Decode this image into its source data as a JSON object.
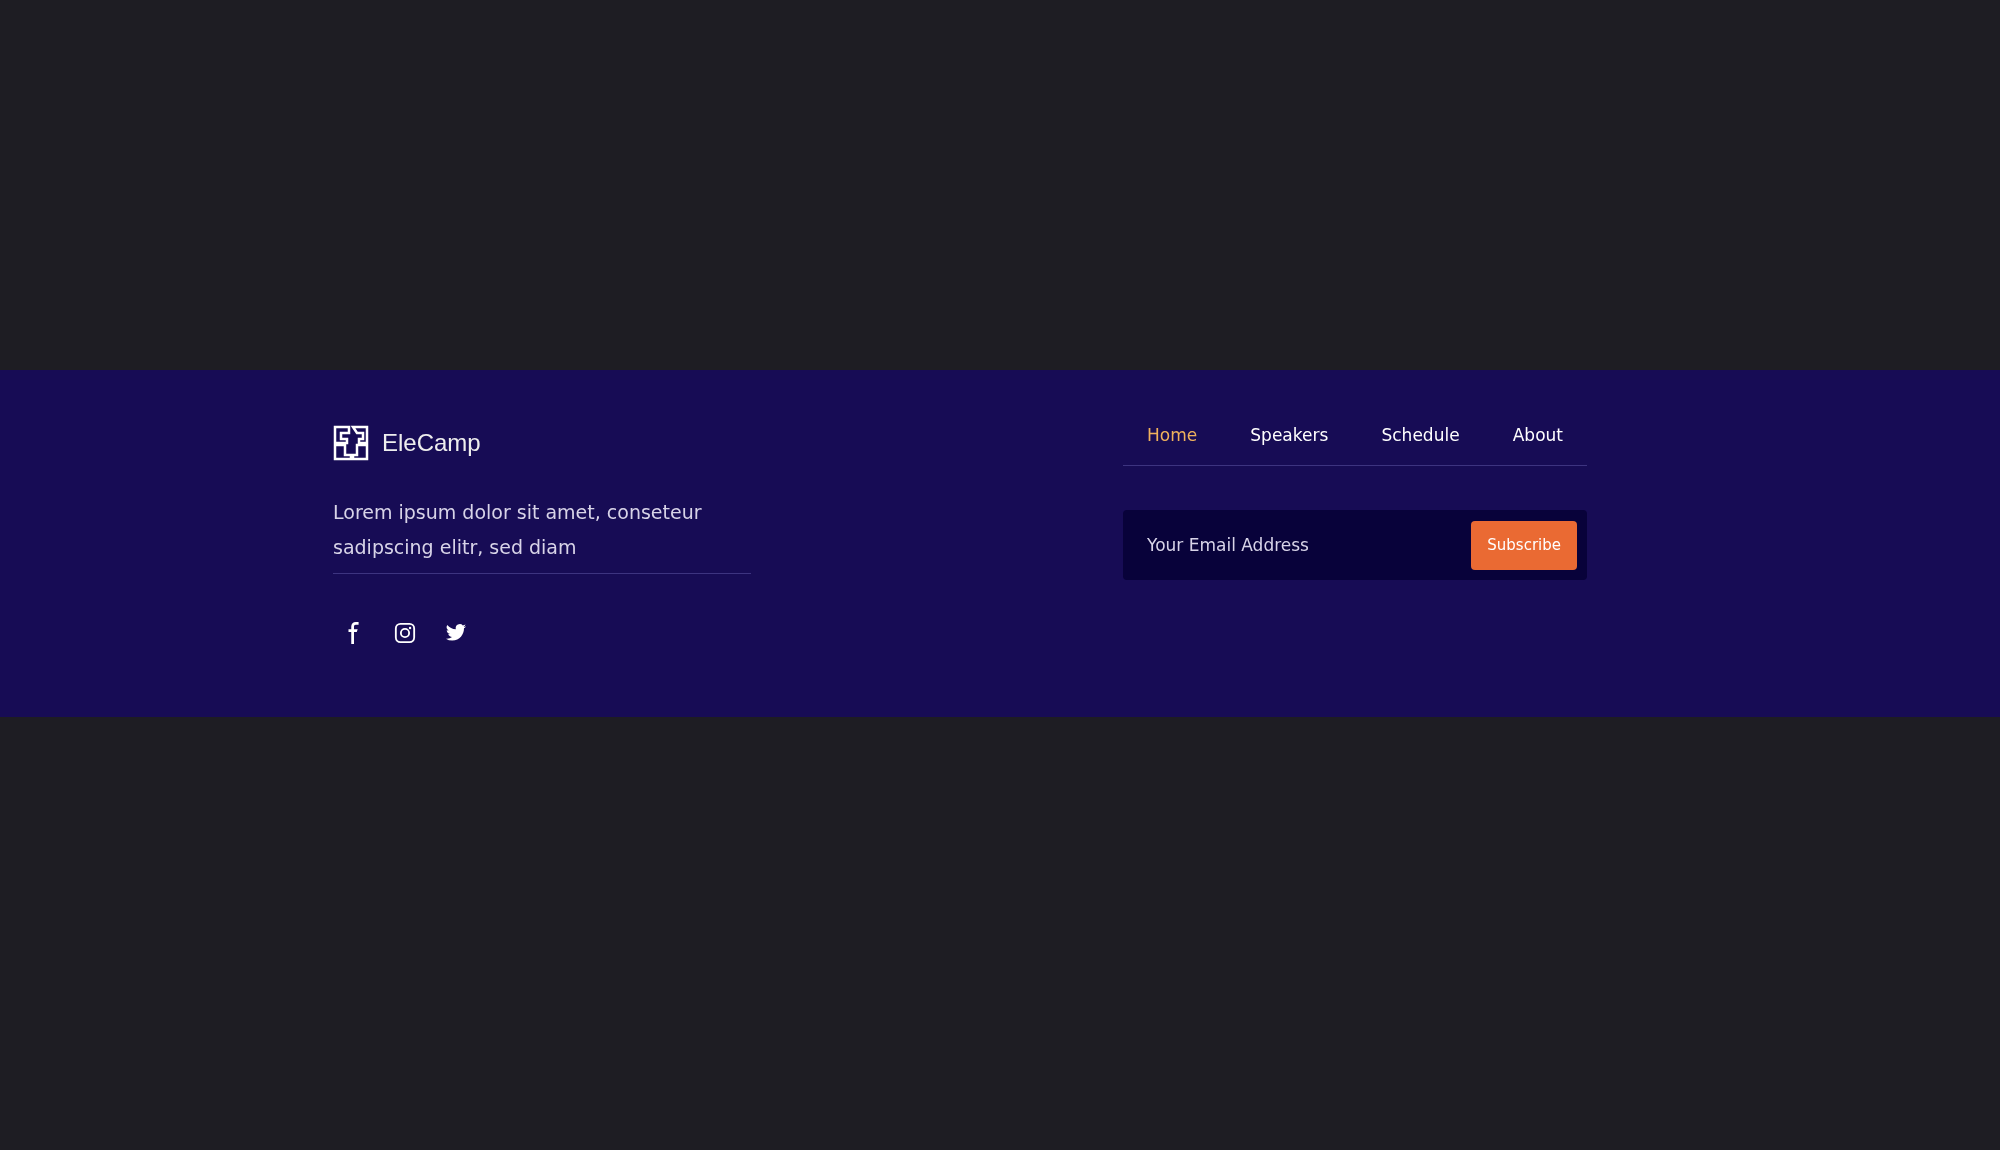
{
  "brand": {
    "name": "EleCamp"
  },
  "description": "Lorem ipsum dolor sit amet, conseteur sadipscing elitr, sed diam",
  "social": [
    {
      "kind": "facebook"
    },
    {
      "kind": "instagram"
    },
    {
      "kind": "twitter"
    }
  ],
  "nav": [
    {
      "label": "Home",
      "selected": true
    },
    {
      "label": "Speakers",
      "selected": false
    },
    {
      "label": "Schedule",
      "selected": false
    },
    {
      "label": "About",
      "selected": false
    }
  ],
  "newsletter": {
    "placeholder": "Your Email Address",
    "button": "Subscribe"
  }
}
